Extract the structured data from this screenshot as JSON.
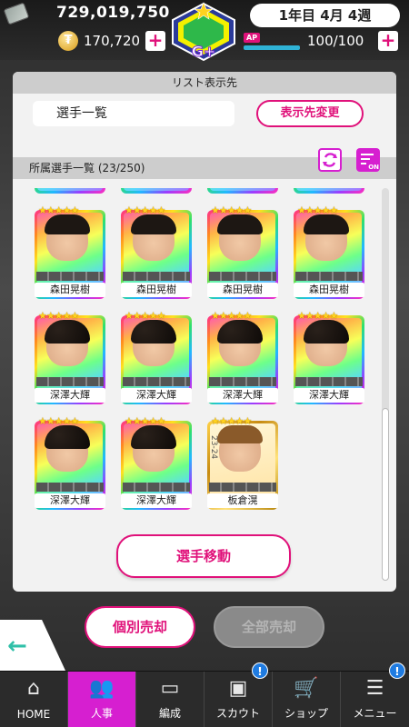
{
  "status": {
    "money": "729,019,750",
    "coins": "170,720",
    "date": "1年目 4月 4週",
    "ap_label": "AP",
    "ap_value": "100/100",
    "plus": "+",
    "logo_text": "G+"
  },
  "list_section": {
    "header": "リスト表示先",
    "current": "選手一覧",
    "change_button": "表示先変更"
  },
  "roster": {
    "header": "所属選手一覧 (23/250)",
    "filter_badge": "ON",
    "rows": [
      [
        {
          "name": "森田晃樹",
          "style": "rainbow",
          "hair": "straight"
        },
        {
          "name": "森田晃樹",
          "style": "rainbow",
          "hair": "straight"
        },
        {
          "name": "森田晃樹",
          "style": "rainbow",
          "hair": "straight"
        },
        {
          "name": "森田晃樹",
          "style": "rainbow",
          "hair": "straight"
        }
      ],
      [
        {
          "name": "深澤大輝",
          "style": "rainbow",
          "hair": "curly"
        },
        {
          "name": "深澤大輝",
          "style": "rainbow",
          "hair": "curly"
        },
        {
          "name": "深澤大輝",
          "style": "rainbow",
          "hair": "curly"
        },
        {
          "name": "深澤大輝",
          "style": "rainbow",
          "hair": "curly"
        }
      ],
      [
        {
          "name": "深澤大輝",
          "style": "rainbow",
          "hair": "curly"
        },
        {
          "name": "深澤大輝",
          "style": "rainbow",
          "hair": "curly"
        },
        {
          "name": "板倉滉",
          "style": "gold",
          "hair": "brown",
          "season": "23-24"
        }
      ]
    ],
    "stars": "★★★★★",
    "move_button": "選手移動"
  },
  "actions": {
    "individual_sell": "個別売却",
    "bulk_sell": "全部売却"
  },
  "nav": [
    {
      "label": "HOME",
      "icon": "home-icon",
      "glyph": "⌂"
    },
    {
      "label": "人事",
      "icon": "people-icon",
      "glyph": "👥",
      "active": true
    },
    {
      "label": "編成",
      "icon": "pitch-icon",
      "glyph": "▭"
    },
    {
      "label": "スカウト",
      "icon": "scout-icon",
      "glyph": "▣",
      "badge": "!"
    },
    {
      "label": "ショップ",
      "icon": "cart-icon",
      "glyph": "🛒"
    },
    {
      "label": "メニュー",
      "icon": "menu-icon",
      "glyph": "☰",
      "badge": "!"
    }
  ],
  "colors": {
    "accent": "#e0117a",
    "nav_active": "#d61fd0",
    "badge": "#1f7be0"
  }
}
